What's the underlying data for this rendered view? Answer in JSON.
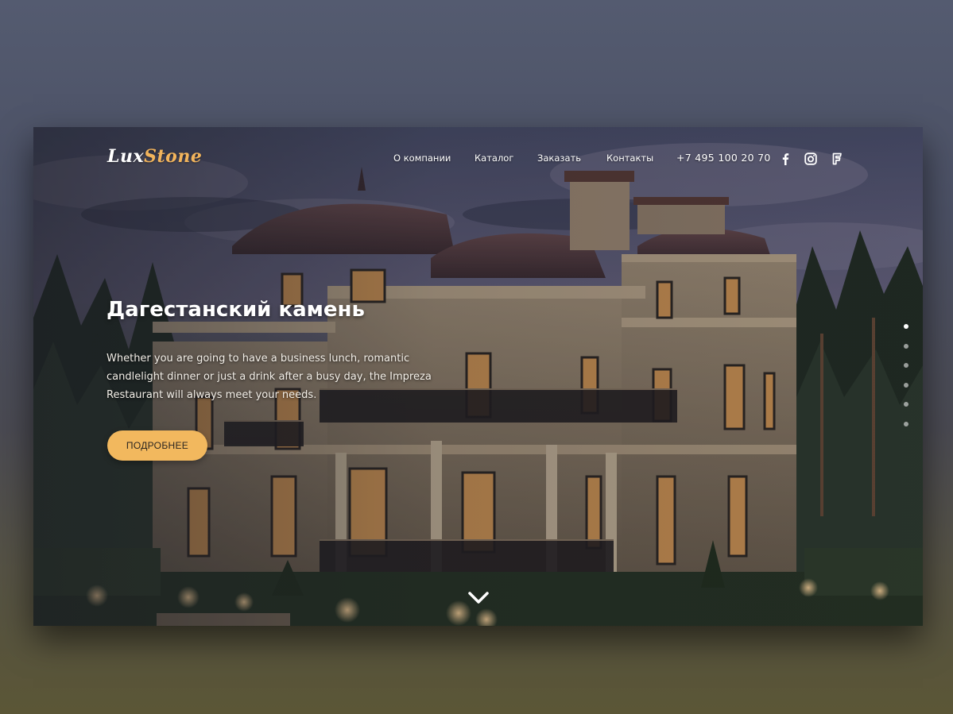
{
  "brand": {
    "logo_part1": "Lux",
    "logo_part2": "Stone"
  },
  "nav": {
    "items": [
      "О компании",
      "Каталог",
      "Заказать",
      "Контакты"
    ]
  },
  "contact": {
    "phone": "+7 495 100 20 70"
  },
  "social": {
    "icons": [
      "facebook-icon",
      "instagram-icon",
      "foursquare-icon"
    ]
  },
  "hero": {
    "title": "Дагестанский камень",
    "description": "Whether you are going to have a business lunch, romantic candlelight dinner or just a drink after a busy day, the Impreza Restaurant will always meet your needs.",
    "cta_label": "ПОДРОБНЕЕ"
  },
  "slider": {
    "total_slides": 6,
    "active_index": 0
  },
  "colors": {
    "accent": "#f2b85e",
    "logo_accent": "#f2b45c",
    "text": "#ffffff"
  }
}
